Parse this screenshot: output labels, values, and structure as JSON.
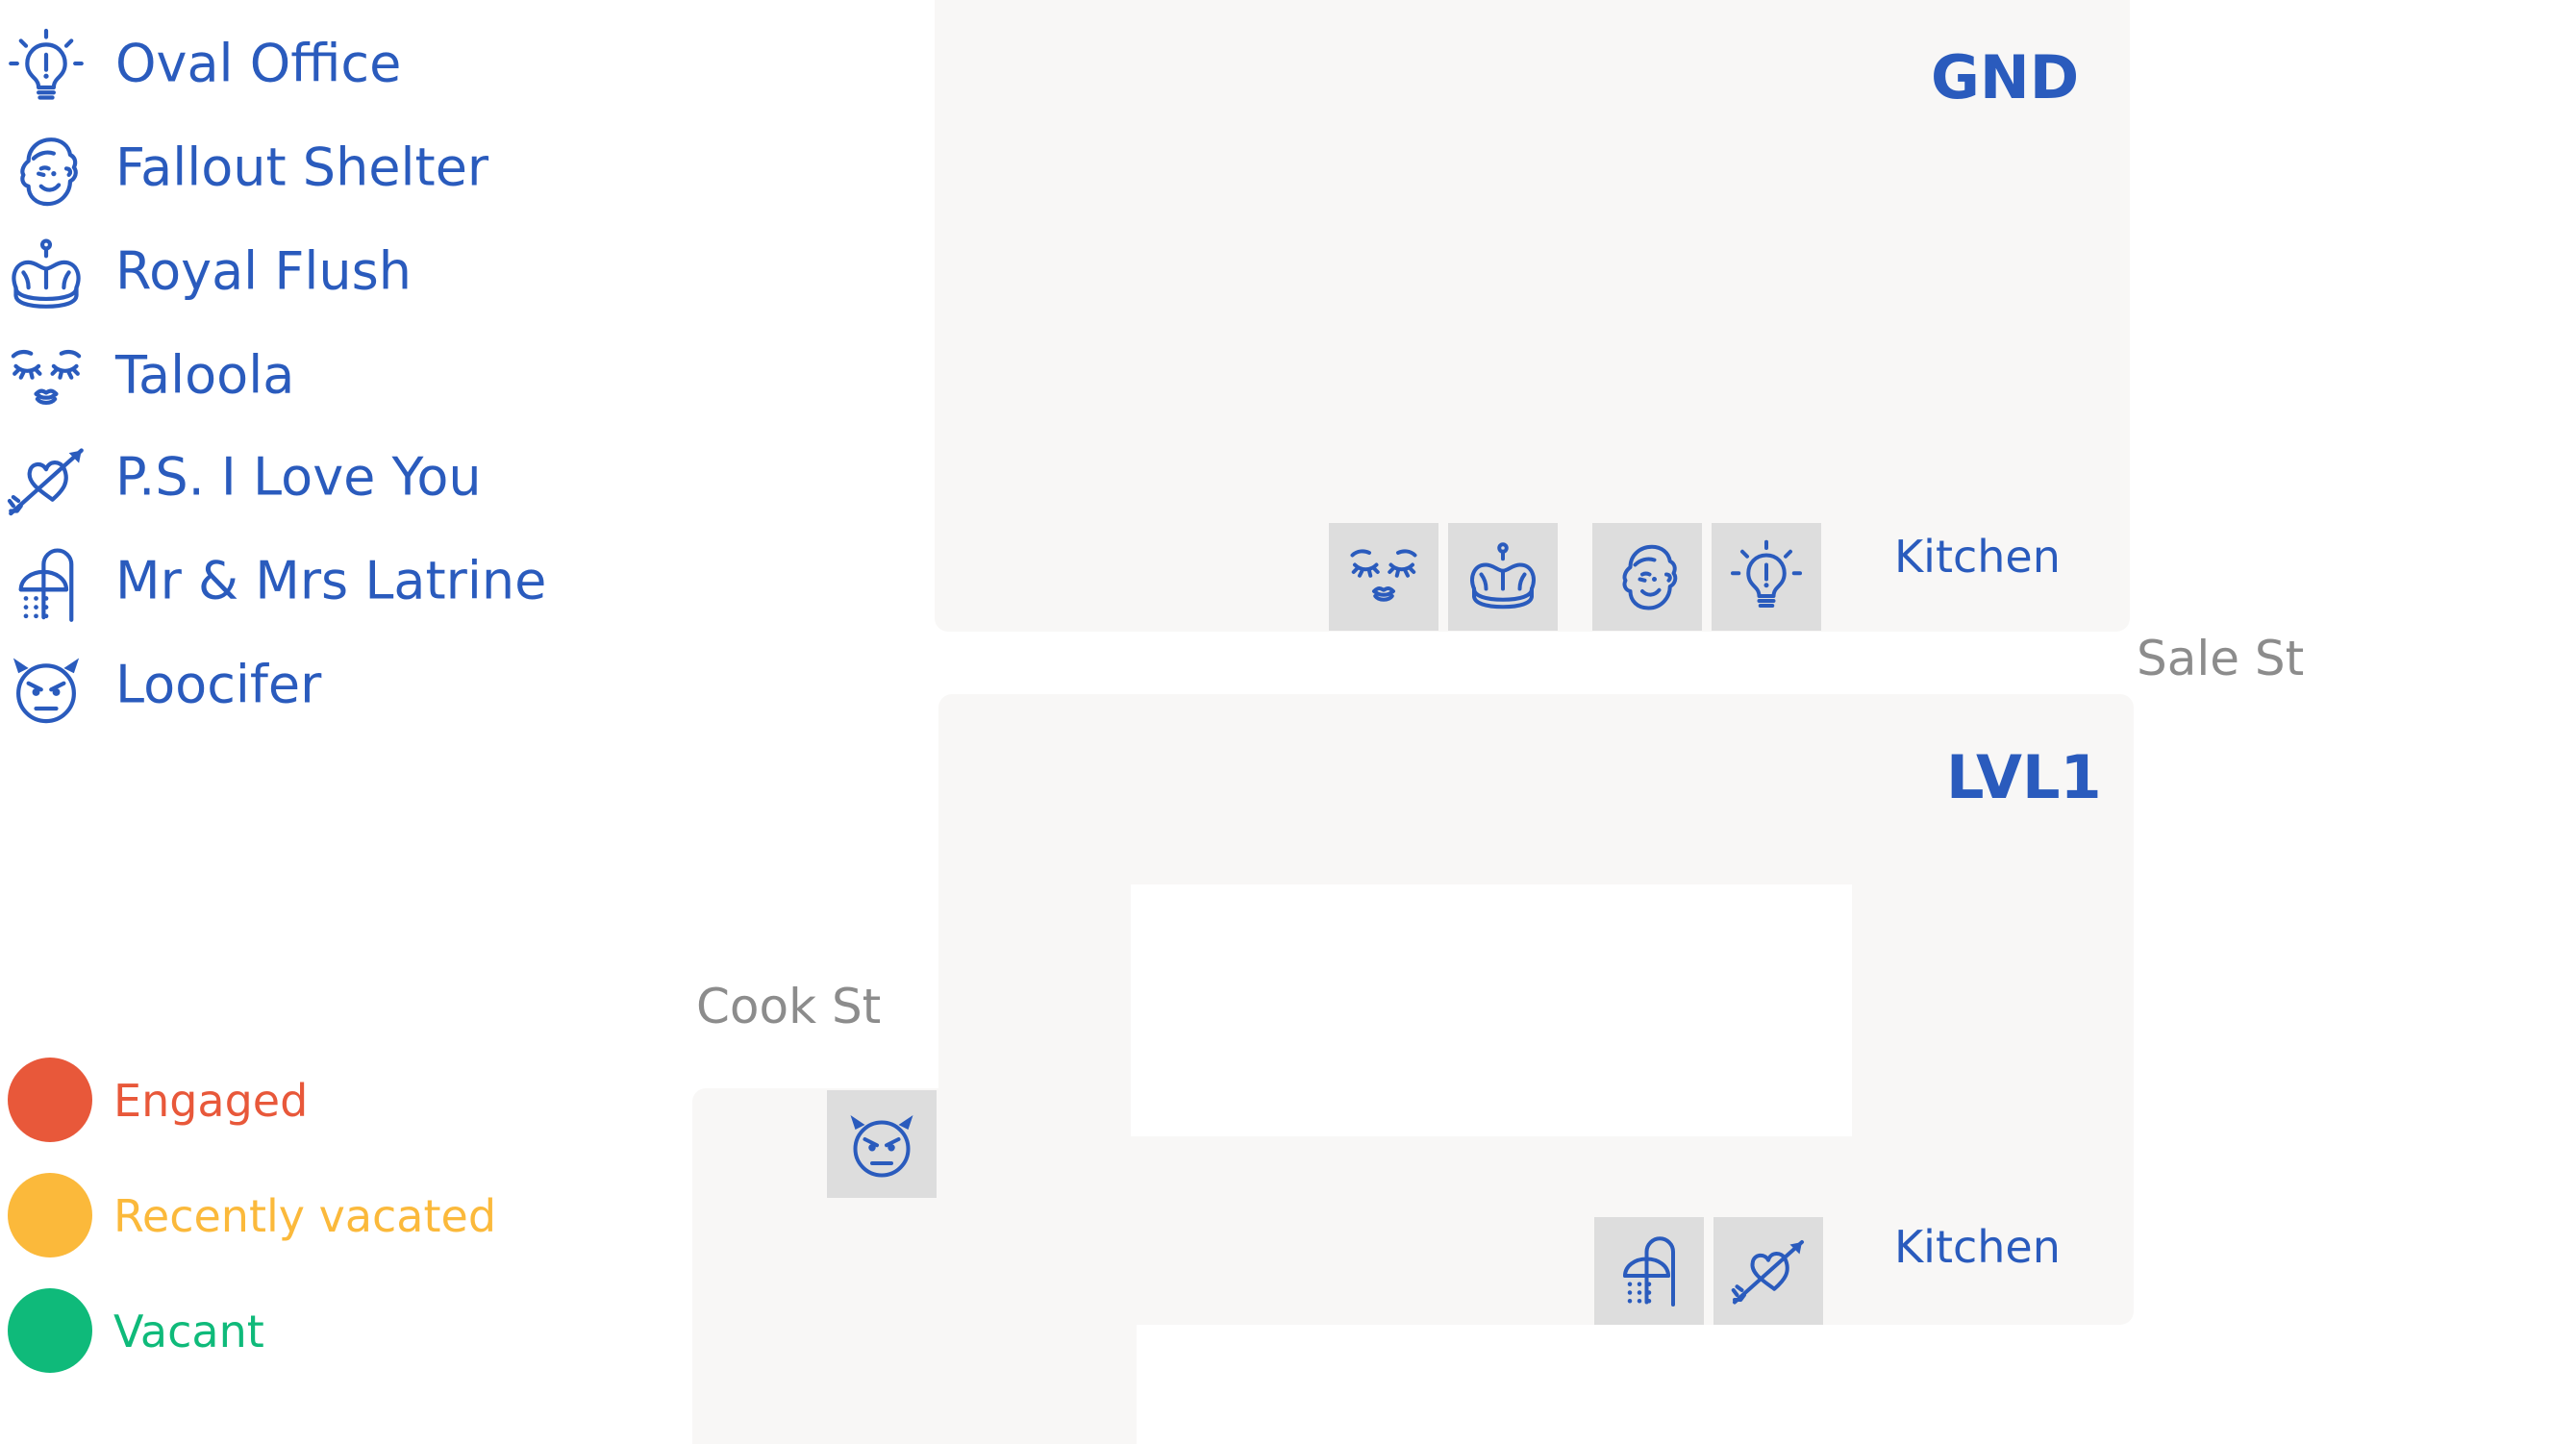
{
  "legend": {
    "toilets": [
      {
        "label": "Oval Office",
        "icon": "lightbulb-icon"
      },
      {
        "label": "Fallout Shelter",
        "icon": "vault-boy-icon"
      },
      {
        "label": "Royal Flush",
        "icon": "crown-icon"
      },
      {
        "label": "Taloola",
        "icon": "kissing-face-icon"
      },
      {
        "label": "P.S. I Love You",
        "icon": "heart-arrow-icon"
      },
      {
        "label": "Mr & Mrs Latrine",
        "icon": "shower-icon"
      },
      {
        "label": "Loocifer",
        "icon": "devil-icon"
      }
    ],
    "statuses": [
      {
        "label": "Engaged",
        "color": "#e8583a"
      },
      {
        "label": "Recently vacated",
        "color": "#fbb93b"
      },
      {
        "label": "Vacant",
        "color": "#0fba7a"
      }
    ]
  },
  "floors": {
    "ground": {
      "name": "GND",
      "kitchen": "Kitchen"
    },
    "level1": {
      "name": "LVL1",
      "kitchen": "Kitchen"
    }
  },
  "streets": {
    "sale": "Sale St",
    "cook": "Cook St"
  },
  "colors": {
    "accent": "#2a5bbd",
    "floor": "#f8f7f6",
    "toilet_tile": "#dddddd",
    "street_text": "#8c8c8c"
  }
}
